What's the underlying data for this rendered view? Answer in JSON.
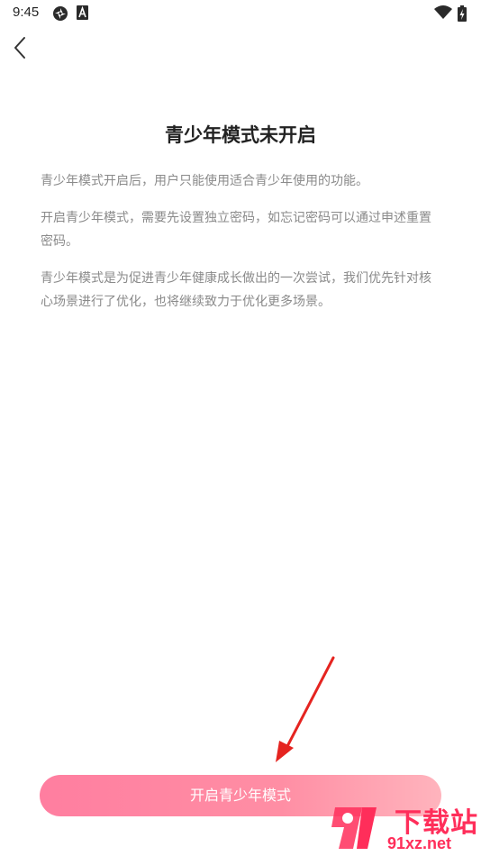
{
  "status_bar": {
    "time": "9:45",
    "icons": [
      "sync-icon",
      "a-badge-icon",
      "wifi-icon",
      "battery-charging-icon"
    ]
  },
  "nav": {
    "back_icon": "chevron-left-icon"
  },
  "page": {
    "title": "青少年模式未开启",
    "paragraphs": [
      "青少年模式开启后，用户只能使用适合青少年使用的功能。",
      "开启青少年模式，需要先设置独立密码，如忘记密码可以通过申述重置密码。",
      "青少年模式是为促进青少年健康成长做出的一次尝试，我们优先针对核心场景进行了优化，也将继续致力于优化更多场景。"
    ]
  },
  "cta": {
    "label": "开启青少年模式"
  },
  "watermark": {
    "title": "下载站",
    "url": "91xz.net"
  },
  "colors": {
    "accent_start": "#ff7ea0",
    "accent_end": "#ffb4bd",
    "watermark": "#ff2e5a",
    "annotation_arrow": "#e52420"
  }
}
